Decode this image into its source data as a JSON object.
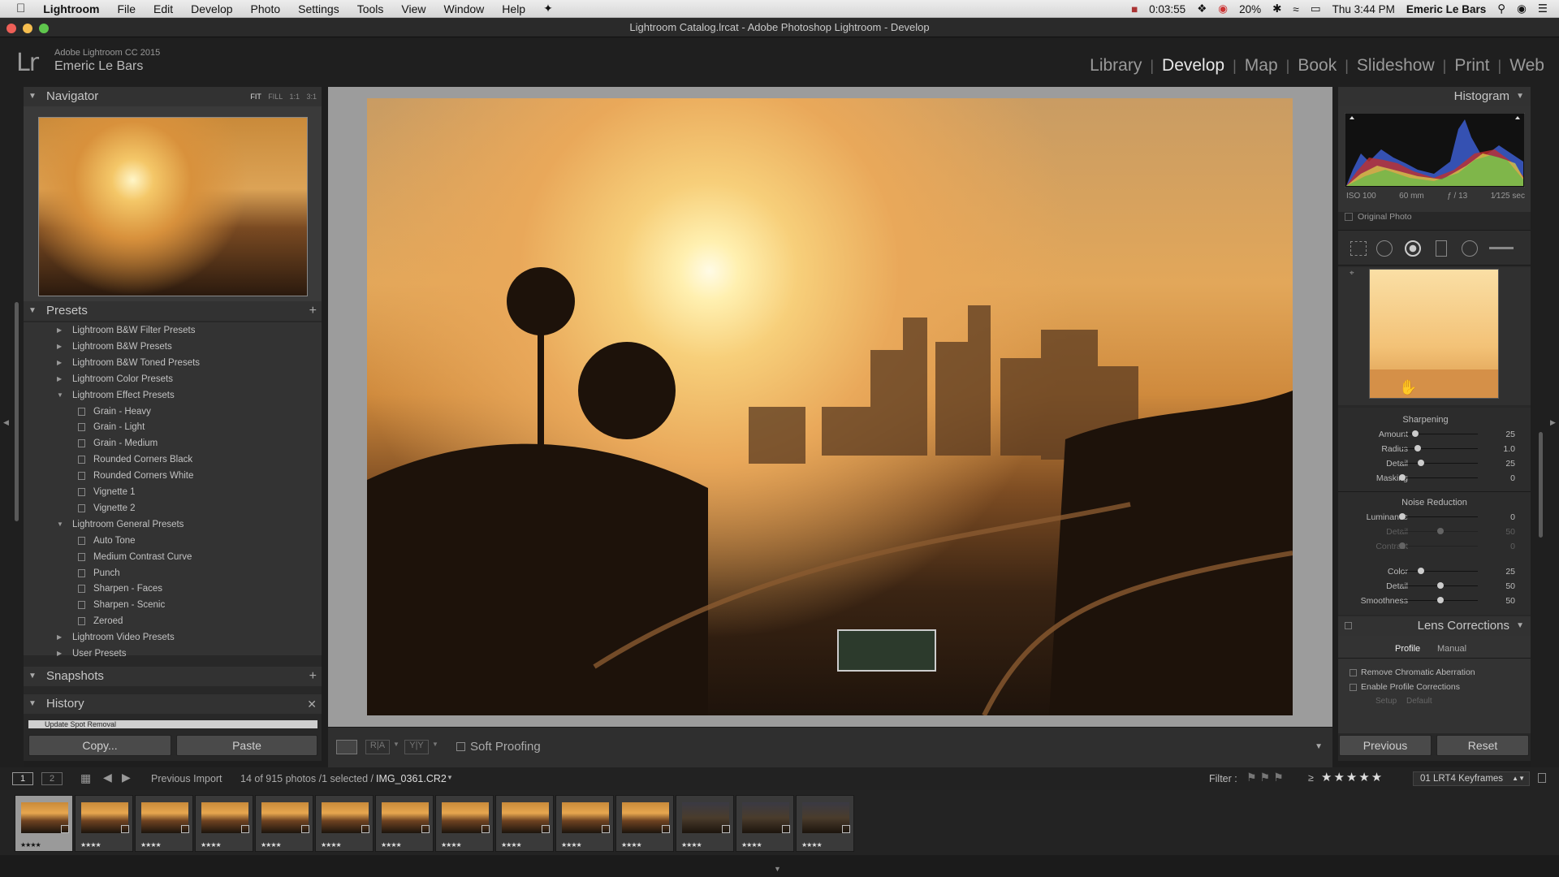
{
  "menubar": {
    "apple": "",
    "items": [
      "Lightroom",
      "File",
      "Edit",
      "Develop",
      "Photo",
      "Settings",
      "Tools",
      "View",
      "Window",
      "Help"
    ],
    "timer": "0:03:55",
    "battery": "20%",
    "clock": "Thu 3:44 PM",
    "user": "Emeric Le Bars"
  },
  "window": {
    "title": "Lightroom Catalog.lrcat - Adobe Photoshop Lightroom - Develop"
  },
  "identity": {
    "logo": "Lr",
    "product": "Adobe Lightroom CC 2015",
    "user": "Emeric Le Bars"
  },
  "modules": [
    "Library",
    "Develop",
    "Map",
    "Book",
    "Slideshow",
    "Print",
    "Web"
  ],
  "navigator": {
    "title": "Navigator",
    "zoom": [
      "FIT",
      "FILL",
      "1:1",
      "3:1"
    ]
  },
  "presets": {
    "title": "Presets",
    "items": [
      {
        "label": "Lightroom B&W Filter Presets",
        "level": 0,
        "open": false
      },
      {
        "label": "Lightroom B&W Presets",
        "level": 0,
        "open": false
      },
      {
        "label": "Lightroom B&W Toned Presets",
        "level": 0,
        "open": false
      },
      {
        "label": "Lightroom Color Presets",
        "level": 0,
        "open": false
      },
      {
        "label": "Lightroom Effect Presets",
        "level": 0,
        "open": true
      },
      {
        "label": "Grain - Heavy",
        "level": 1
      },
      {
        "label": "Grain - Light",
        "level": 1
      },
      {
        "label": "Grain - Medium",
        "level": 1
      },
      {
        "label": "Rounded Corners Black",
        "level": 1
      },
      {
        "label": "Rounded Corners White",
        "level": 1
      },
      {
        "label": "Vignette 1",
        "level": 1
      },
      {
        "label": "Vignette 2",
        "level": 1
      },
      {
        "label": "Lightroom General Presets",
        "level": 0,
        "open": true
      },
      {
        "label": "Auto Tone",
        "level": 1
      },
      {
        "label": "Medium Contrast Curve",
        "level": 1
      },
      {
        "label": "Punch",
        "level": 1
      },
      {
        "label": "Sharpen - Faces",
        "level": 1
      },
      {
        "label": "Sharpen - Scenic",
        "level": 1
      },
      {
        "label": "Zeroed",
        "level": 1
      },
      {
        "label": "Lightroom Video Presets",
        "level": 0,
        "open": false
      },
      {
        "label": "User Presets",
        "level": 0,
        "open": false
      }
    ]
  },
  "snapshots": {
    "title": "Snapshots"
  },
  "history": {
    "title": "History",
    "item": "Update Spot Removal"
  },
  "left_buttons": {
    "copy": "Copy...",
    "paste": "Paste"
  },
  "toolbar": {
    "soft_proofing": "Soft Proofing"
  },
  "histogram": {
    "title": "Histogram",
    "iso": "ISO 100",
    "focal": "60 mm",
    "aperture": "ƒ / 13",
    "shutter": "1⁄125 sec",
    "original_photo": "Original Photo"
  },
  "detail": {
    "sharpening_title": "Sharpening",
    "sharpening": [
      {
        "label": "Amount",
        "value": "25",
        "pos": 0.17
      },
      {
        "label": "Radius",
        "value": "1.0",
        "pos": 0.2
      },
      {
        "label": "Detail",
        "value": "25",
        "pos": 0.25
      },
      {
        "label": "Masking",
        "value": "0",
        "pos": 0.0
      }
    ],
    "noise_title": "Noise Reduction",
    "noise": [
      {
        "label": "Luminance",
        "value": "0",
        "pos": 0.0
      },
      {
        "label": "Detail",
        "value": "50",
        "pos": 0.5,
        "dim": true
      },
      {
        "label": "Contrast",
        "value": "0",
        "pos": 0.0,
        "dim": true
      },
      {
        "label": "Color",
        "value": "25",
        "pos": 0.25
      },
      {
        "label": "Detail",
        "value": "50",
        "pos": 0.5
      },
      {
        "label": "Smoothness",
        "value": "50",
        "pos": 0.5
      }
    ]
  },
  "lens": {
    "title": "Lens Corrections",
    "tabs": [
      "Profile",
      "Manual"
    ],
    "remove_ca": "Remove Chromatic Aberration",
    "enable_profile": "Enable Profile Corrections",
    "setup_label": "Setup",
    "setup_value": "Default"
  },
  "right_buttons": {
    "previous": "Previous",
    "reset": "Reset"
  },
  "filmbar": {
    "screen1": "1",
    "screen2": "2",
    "source": "Previous Import",
    "count": "14 of 915 photos /1 selected /",
    "file": "IMG_0361.CR2",
    "filter_label": "Filter :",
    "rating_op": "≥",
    "stars": "★★★★★",
    "filter_preset": "01 LRT4 Keyframes"
  },
  "filmstrip": {
    "count": 14,
    "stars": "★★★★"
  },
  "colors": {
    "accent": "#e6b35a",
    "panel": "#282828",
    "active_text": "#e8e8e8"
  }
}
